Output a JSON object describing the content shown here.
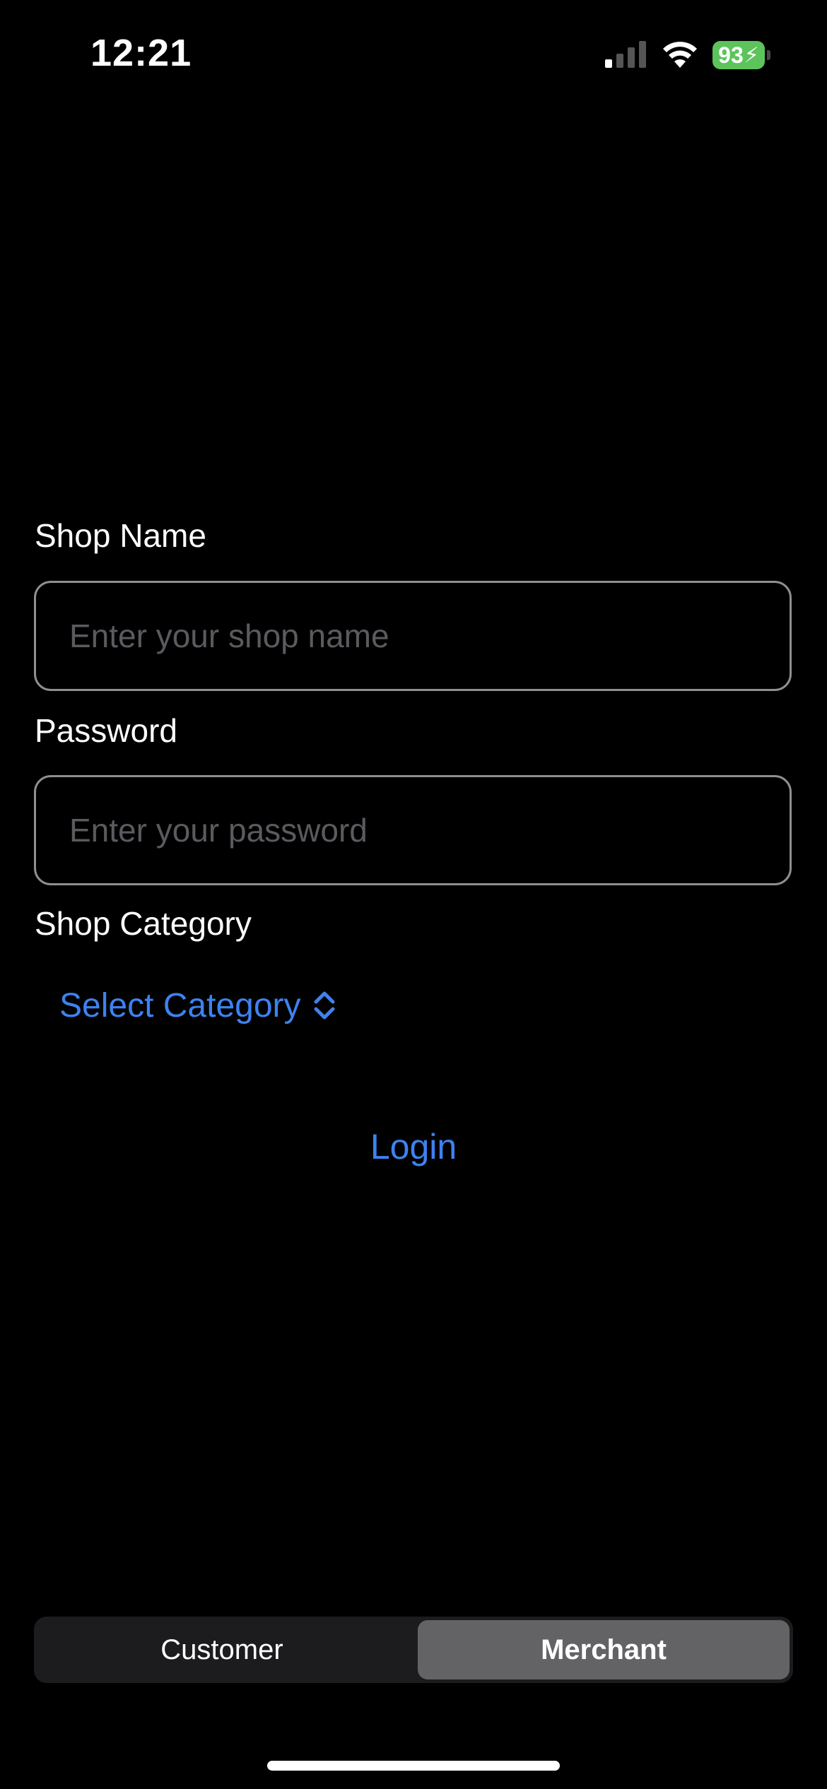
{
  "status_bar": {
    "time": "12:21",
    "battery_level": "93",
    "battery_color": "#5cc45b",
    "signal_bars_active": 1,
    "signal_bars_total": 4,
    "charging": true
  },
  "form": {
    "shop_name": {
      "label": "Shop Name",
      "value": "",
      "placeholder": "Enter your shop name"
    },
    "password": {
      "label": "Password",
      "value": "",
      "placeholder": "Enter your password"
    },
    "shop_category": {
      "label": "Shop Category",
      "selected": "Select Category"
    },
    "login_label": "Login"
  },
  "segmented_control": {
    "options": [
      "Customer",
      "Merchant"
    ],
    "selected": "Merchant"
  },
  "colors": {
    "accent": "#3d82f0",
    "background": "#000000",
    "field_border": "#8e8e93",
    "selected_segment": "#636366"
  }
}
